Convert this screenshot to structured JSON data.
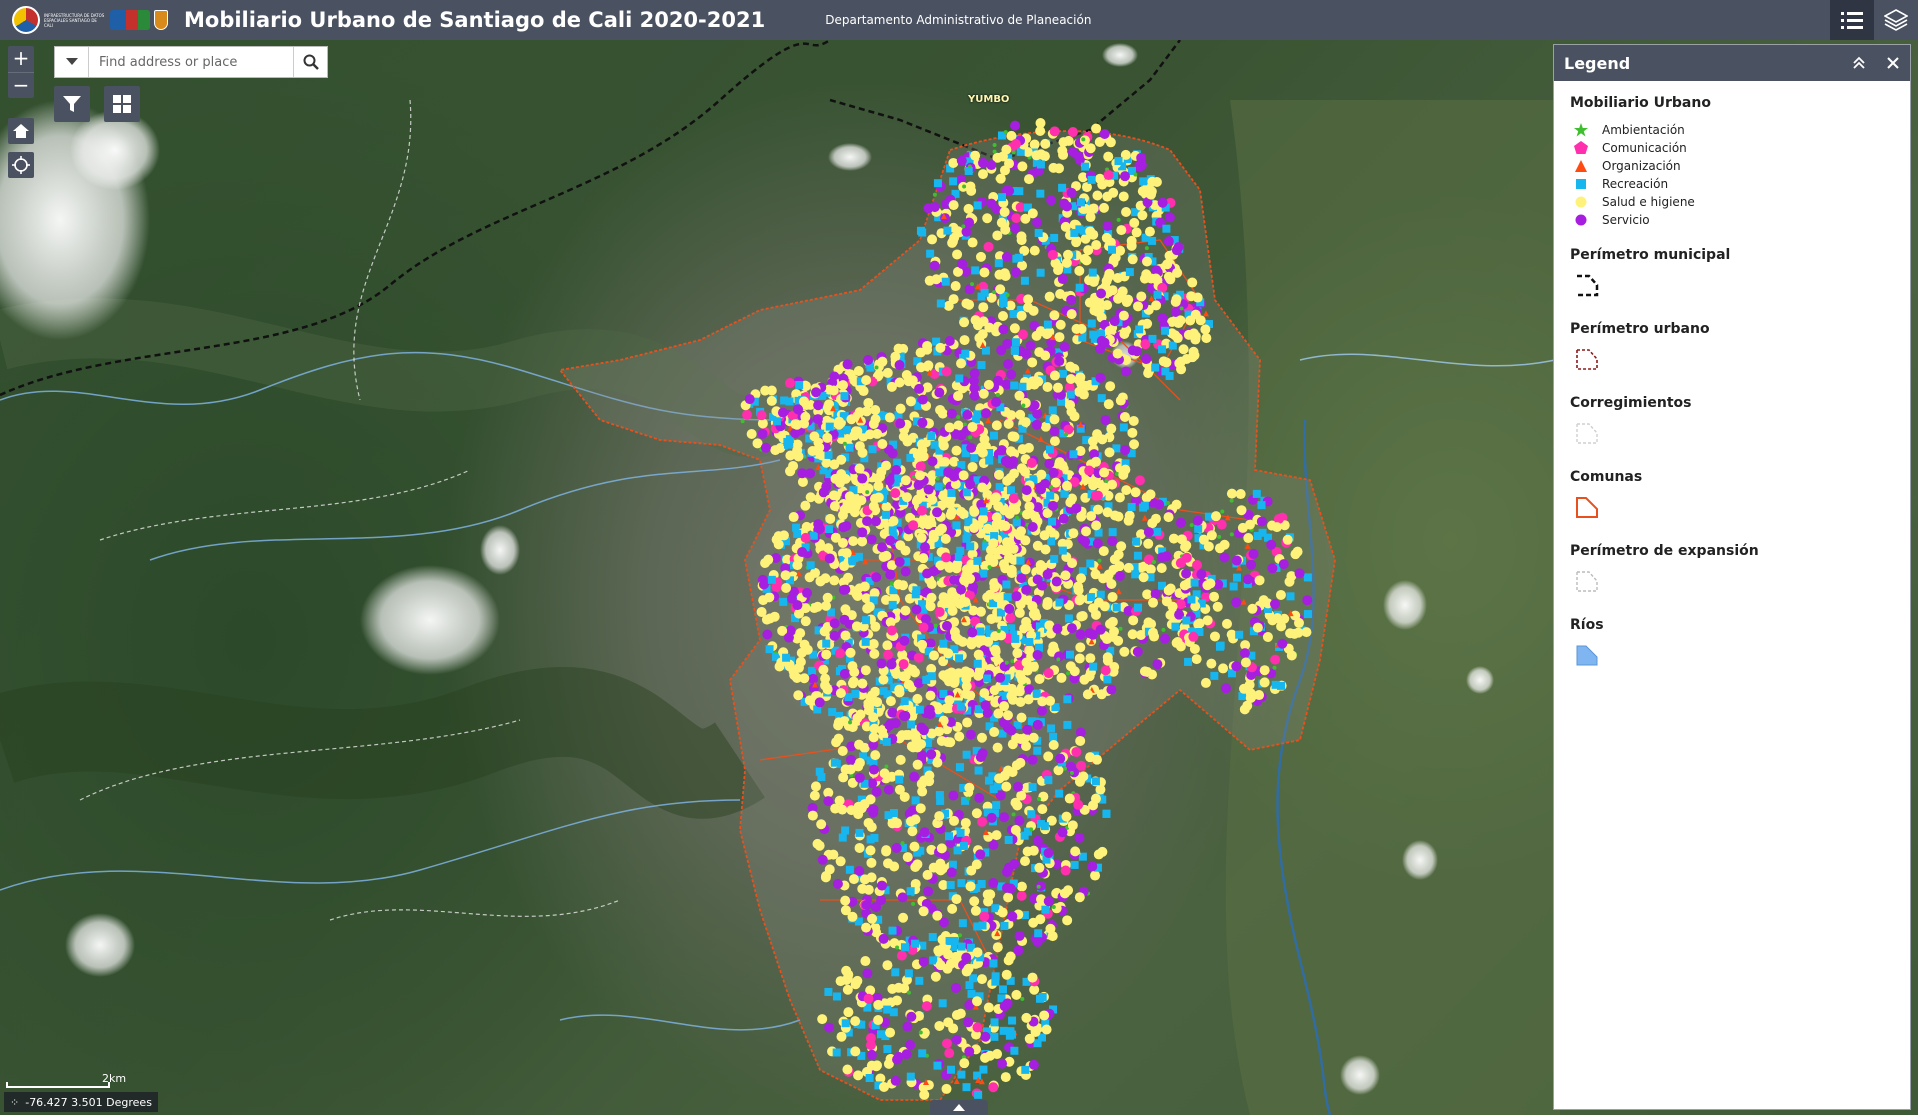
{
  "header": {
    "logo_text": "INFRAESTRUCTURA DE DATOS ESPACIALES SANTIAGO DE CALI",
    "title": "Mobiliario Urbano de Santiago de Cali 2020-2021",
    "subtitle": "Departamento Administrativo de Planeación",
    "tools": [
      "legend-list-icon",
      "layers-icon"
    ]
  },
  "search": {
    "placeholder": "Find address or place"
  },
  "map": {
    "place_label": "YUMBO",
    "scale_label": "2km",
    "coordinates": "-76.427 3.501 Degrees"
  },
  "legend": {
    "title": "Legend",
    "sections": [
      {
        "title": "Mobiliario Urbano",
        "items": [
          {
            "label": "Ambientación",
            "symbol": "star",
            "color": "#3fbf2f"
          },
          {
            "label": "Comunicación",
            "symbol": "pentagon",
            "color": "#ff2fae"
          },
          {
            "label": "Organización",
            "symbol": "triangle",
            "color": "#ff4a12"
          },
          {
            "label": "Recreación",
            "symbol": "square",
            "color": "#17b6ef"
          },
          {
            "label": "Salud e higiene",
            "symbol": "circle",
            "color": "#fff27a"
          },
          {
            "label": "Servicio",
            "symbol": "circle",
            "color": "#a61ee0"
          }
        ]
      },
      {
        "title": "Perímetro municipal",
        "swatch": "dash-black"
      },
      {
        "title": "Perímetro urbano",
        "swatch": "dash-darkred"
      },
      {
        "title": "Corregimientos",
        "swatch": "dash-grey"
      },
      {
        "title": "Comunas",
        "swatch": "orange-outline"
      },
      {
        "title": "Perímetro de expansión",
        "swatch": "dash-lightgrey"
      },
      {
        "title": "Ríos",
        "swatch": "blue-fill"
      }
    ]
  }
}
